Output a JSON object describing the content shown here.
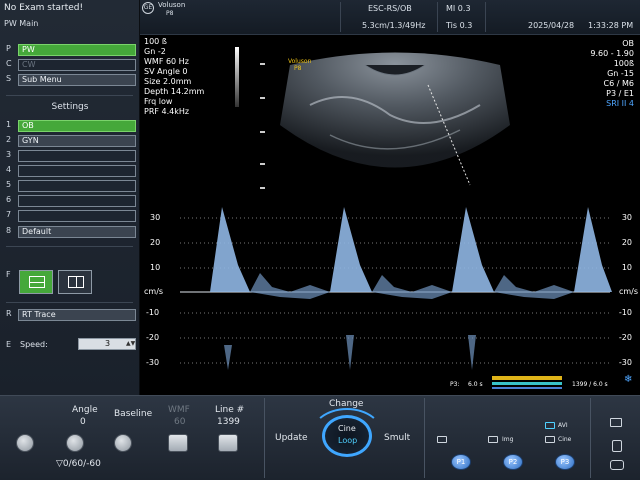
{
  "left_panel": {
    "status": "No Exam started!",
    "mode": "PW Main",
    "menu": [
      {
        "key": "P",
        "label": "PW",
        "state": "active"
      },
      {
        "key": "C",
        "label": "CW",
        "state": "disabled"
      },
      {
        "key": "S",
        "label": "Sub Menu",
        "state": "normal"
      }
    ],
    "settings_title": "Settings",
    "settings": [
      {
        "key": "1",
        "label": "OB",
        "state": "active"
      },
      {
        "key": "2",
        "label": "GYN",
        "state": "normal"
      },
      {
        "key": "3",
        "label": "",
        "state": "empty"
      },
      {
        "key": "4",
        "label": "",
        "state": "empty"
      },
      {
        "key": "5",
        "label": "",
        "state": "empty"
      },
      {
        "key": "6",
        "label": "",
        "state": "empty"
      },
      {
        "key": "7",
        "label": "",
        "state": "empty"
      },
      {
        "key": "8",
        "label": "Default",
        "state": "normal"
      }
    ],
    "f_key": "F",
    "r_key": "R",
    "r_label": "RT Trace",
    "e_key": "E",
    "speed_label": "Speed:",
    "speed_value": "3"
  },
  "top_bar": {
    "brand_line1": "Voluson",
    "brand_line2": "P8",
    "probe": "ESC-RS/OB",
    "mi_label": "MI 0.3",
    "depth_rate": "5.3cm/1.3/49Hz",
    "tis_label": "Tis 0.3",
    "date": "2025/04/28",
    "time": "1:33:28 PM"
  },
  "overlay_left": [
    "100 ß",
    "Gn -2",
    "WMF 60 Hz",
    "SV Angle 0",
    "Size 2.0mm",
    "Depth 14.2mm",
    "Frq low",
    "PRF 4.4kHz"
  ],
  "overlay_right": [
    "OB",
    "9.60 - 1.90",
    "100ß",
    "Gn -15",
    "C6 / M6",
    "P3 / E1",
    "SRI II 4"
  ],
  "image_brand": {
    "line1": "Voluson",
    "line2": "P8"
  },
  "doppler": {
    "unit_label": "cm/s",
    "ticks_left": [
      "30",
      "20",
      "10",
      "cm/s",
      "-10",
      "-20",
      "-30"
    ],
    "ticks_right": [
      "30",
      "20",
      "10",
      "cm/s",
      "-10",
      "-20",
      "-30"
    ],
    "p3_label": "P3:",
    "p3_value": "6.0 s",
    "frame_label": "1399 / 6.0 s"
  },
  "bottom_panel": {
    "angle_label": "Angle",
    "angle_value": "0",
    "baseline_label": "Baseline",
    "wmf_label": "WMF",
    "wmf_value": "60",
    "line_label": "Line #",
    "line_value": "1399",
    "angle_presets": "▽0/60/-60",
    "change_label": "Change",
    "update_label": "Update",
    "cine_label": "Cine",
    "loop_label": "Loop",
    "smult_label": "Smult",
    "avi_label": "AVI",
    "img_label": "Img",
    "cine2_label": "Cine",
    "p1": "P1",
    "p2": "P2",
    "p3": "P3"
  }
}
